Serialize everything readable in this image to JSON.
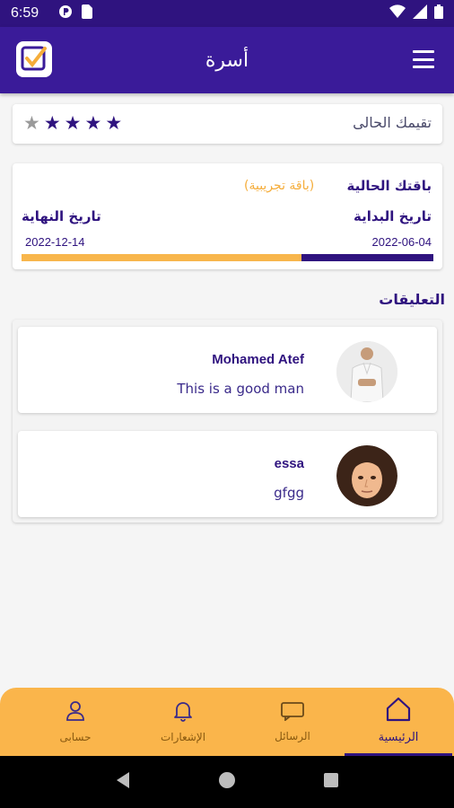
{
  "status_bar": {
    "time": "6:59"
  },
  "app_bar": {
    "title": "أسرة"
  },
  "rating": {
    "label": "تقيمك الحالى",
    "filled_stars": 4,
    "total_stars": 5
  },
  "package": {
    "title": "باقتك الحالية",
    "type": "(باقة تجريبية)",
    "start_label": "تاريخ البداية",
    "end_label": "تاريخ النهاية",
    "start_date": "2022-06-04",
    "end_date": "2022-12-14",
    "elapsed_fraction": 0.32
  },
  "comments": {
    "heading": "التعليقات",
    "items": [
      {
        "name": "Mohamed Atef",
        "text": "This is a good man"
      },
      {
        "name": "essa",
        "text": "gfgg"
      }
    ]
  },
  "bottom_nav": {
    "items": [
      {
        "label": "الرئيسية",
        "icon": "home-icon",
        "active": true
      },
      {
        "label": "الرسائل",
        "icon": "message-icon",
        "active": false
      },
      {
        "label": "الإشعارات",
        "icon": "bell-icon",
        "active": false
      },
      {
        "label": "حسابى",
        "icon": "user-icon",
        "active": false
      }
    ]
  },
  "colors": {
    "primary": "#3a1b99",
    "accent": "#fab54b",
    "background": "#f5f5f5"
  }
}
